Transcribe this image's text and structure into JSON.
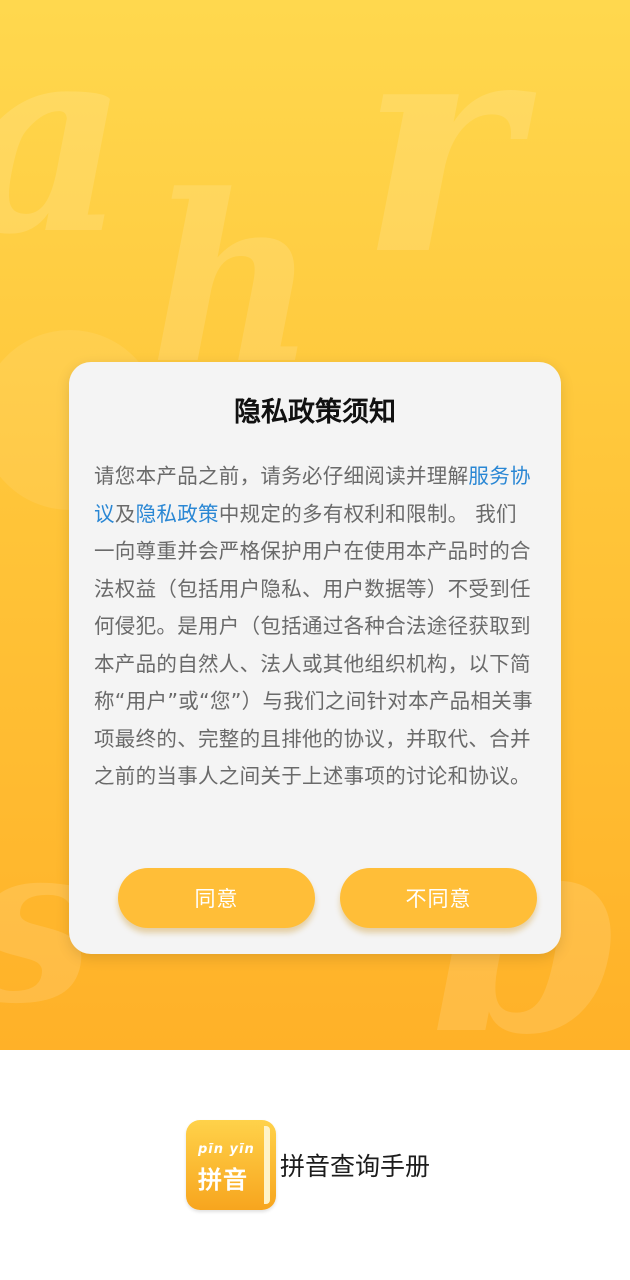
{
  "dialog": {
    "title": "隐私政策须知",
    "body_intro": "请您本产品之前，请务必仔细阅读并理解",
    "link_service": "服务协议",
    "conjunction": "及",
    "link_privacy": "隐私政策",
    "body_rest": "中规定的多有权利和限制。 我们一向尊重并会严格保护用户在使用本产品时的合法权益（包括用户隐私、用户数据等）不受到任何侵犯。是用户（包括通过各种合法途径获取到本产品的自然人、法人或其他组织机构，以下简称“用户”或“您”）与我们之间针对本产品相关事项最终的、完整的且排他的协议，并取代、合并之前的当事人之间关于上述事项的讨论和协议。",
    "agree_label": "同意",
    "disagree_label": "不同意"
  },
  "footer": {
    "icon_pinyin": "pīn yīn",
    "icon_hanzi": "拼音",
    "app_name": "拼音查询手册"
  },
  "colors": {
    "background_top": "#ffd84e",
    "background_bottom": "#ffb128",
    "button": "#ffbe38",
    "link": "#2a87d4"
  },
  "icons": [
    "app-icon"
  ]
}
